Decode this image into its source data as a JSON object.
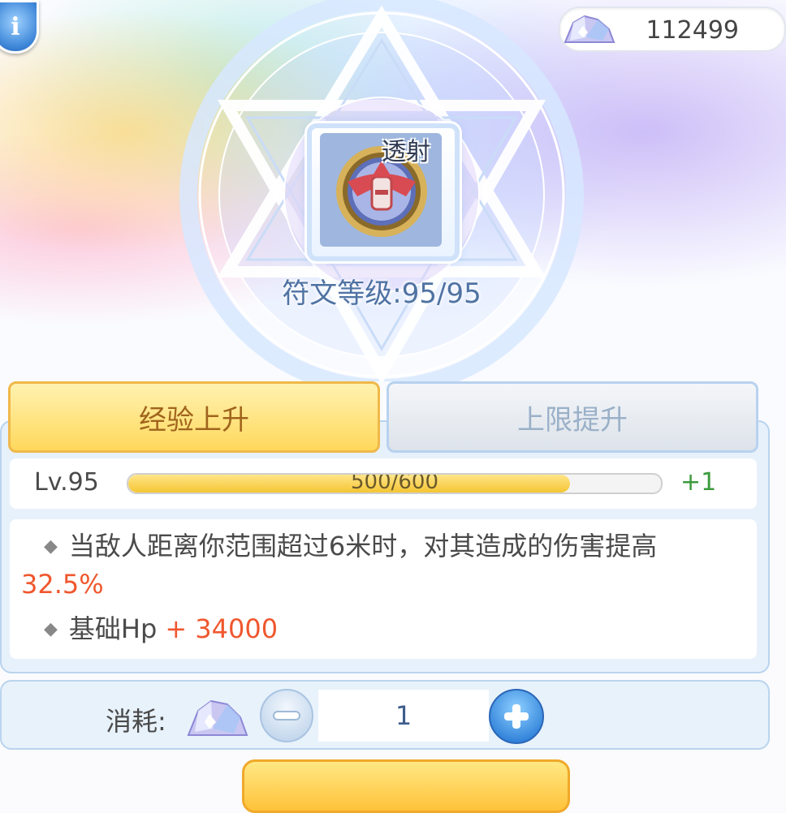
{
  "header": {
    "info_icon": "info-icon",
    "currency": {
      "icon": "crystal-icon",
      "amount": "112499"
    }
  },
  "rune": {
    "icon": "rune-piercing-icon",
    "name": "透射",
    "level_text": "符文等级:95/95"
  },
  "tabs": [
    {
      "label": "经验上升",
      "active": true
    },
    {
      "label": "上限提升",
      "active": false
    }
  ],
  "level": {
    "label": "Lv.95",
    "progress_text": "500/600",
    "progress_fraction": 0.83,
    "gain": "+1"
  },
  "effects": [
    {
      "text": "当敌人距离你范围超过6米时，对其造成的伤害提高",
      "value": "32.5%"
    },
    {
      "text": "基础Hp",
      "value": "+ 34000"
    }
  ],
  "cost": {
    "label": "消耗:",
    "icon": "crystal-icon",
    "quantity": "1",
    "minus_icon": "minus-icon",
    "plus_icon": "plus-icon"
  },
  "colors": {
    "accent_yellow": "#ffd85c",
    "highlight_red": "#f0572e",
    "gain_green": "#3c9a3c",
    "panel_blue": "#e7f1fb"
  }
}
